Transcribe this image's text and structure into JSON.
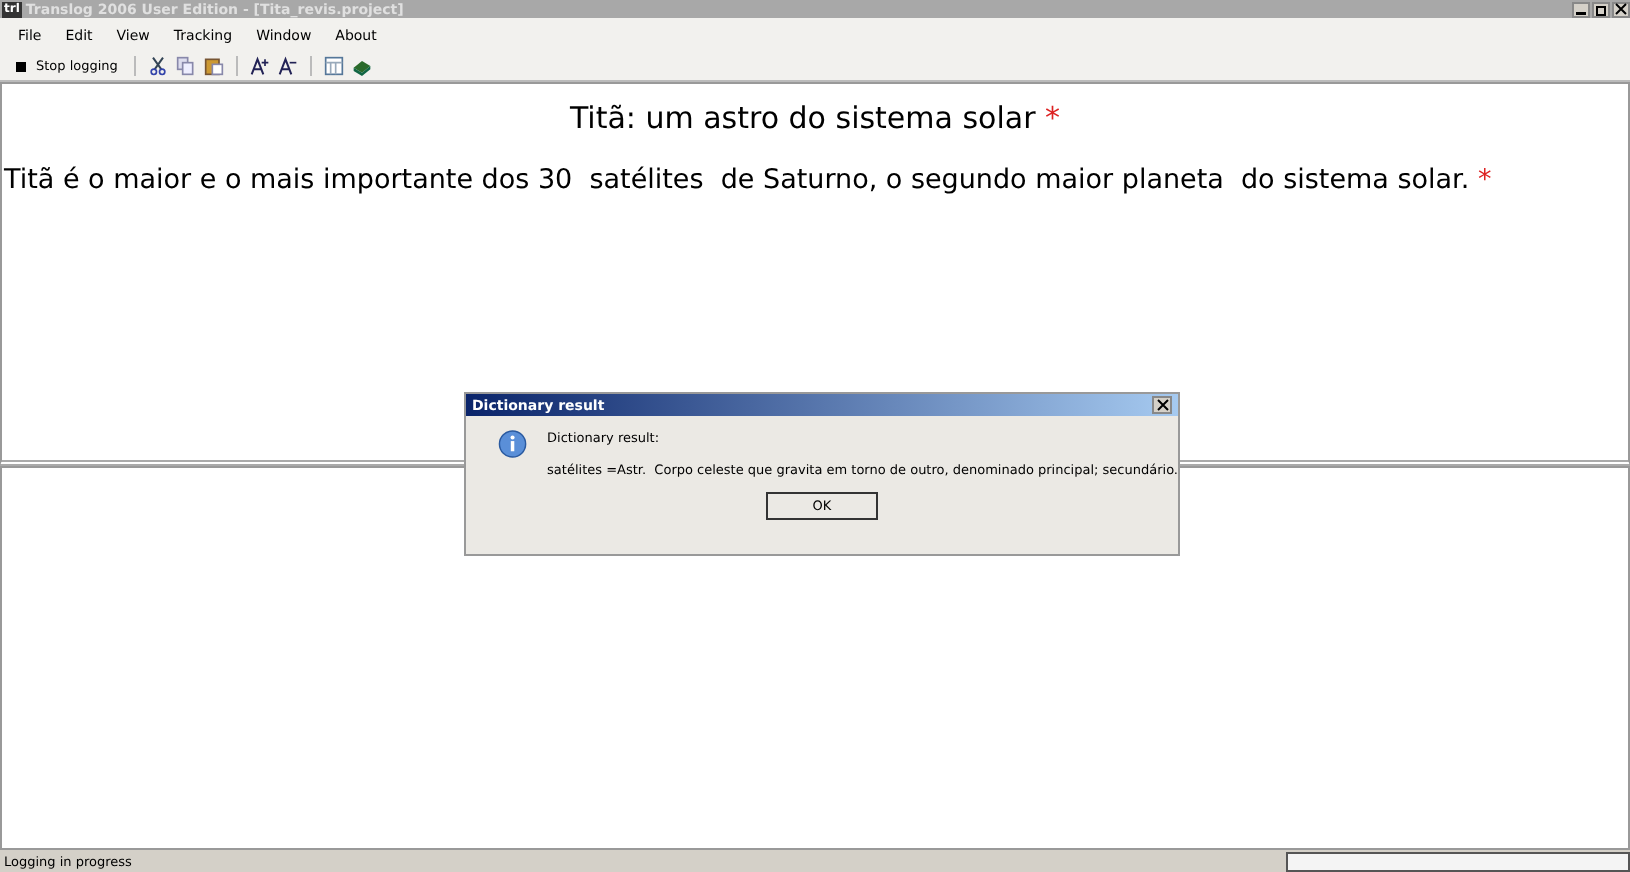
{
  "window": {
    "title": "Translog 2006 User Edition - [Tita_revis.project]",
    "app_icon": "trl"
  },
  "menu": [
    "File",
    "Edit",
    "View",
    "Tracking",
    "Window",
    "About"
  ],
  "toolbar": {
    "stop_label": "Stop logging"
  },
  "document": {
    "title": "Titã: um astro do sistema solar",
    "title_mark": "*",
    "body": "Titã é o maior e o mais importante dos 30  satélites  de Saturno, o segundo maior planeta  do sistema solar.",
    "body_mark": "*"
  },
  "dialog": {
    "title": "Dictionary result",
    "heading": "Dictionary result:",
    "message": "satélites =Astr.  Corpo celeste que gravita em torno de outro, denominado principal; secundário.",
    "button": "OK"
  },
  "status_bar": {
    "text": "Logging in progress"
  }
}
